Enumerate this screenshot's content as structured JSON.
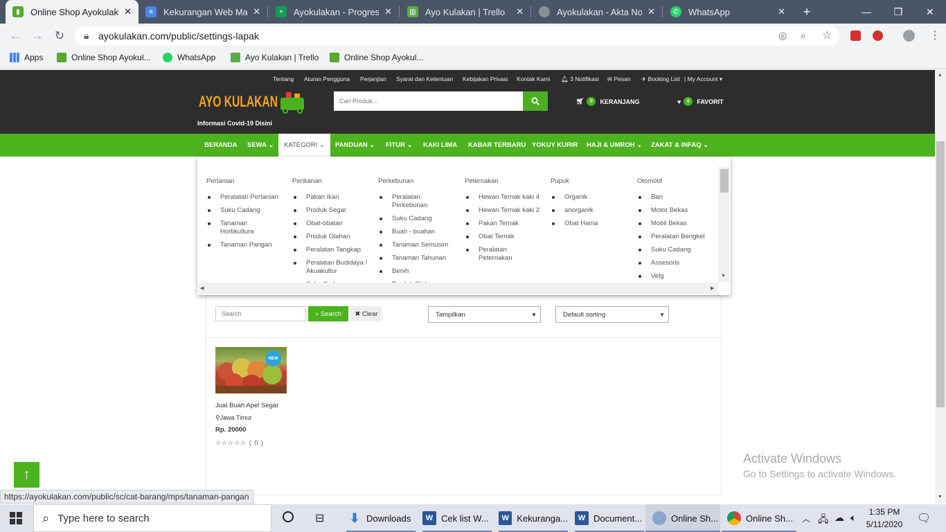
{
  "browser": {
    "tabs": [
      {
        "title": "Online Shop Ayokulakan",
        "active": true
      },
      {
        "title": "Kekurangan Web Market"
      },
      {
        "title": "Ayokulakan - Progress"
      },
      {
        "title": "Ayo Kulakan | Trello"
      },
      {
        "title": "Ayokulakan - Akta Notaris"
      },
      {
        "title": "WhatsApp"
      }
    ],
    "url": "ayokulakan.com/public/settings-lapak",
    "bookmarks": [
      "Apps",
      "Online Shop Ayokul...",
      "WhatsApp",
      "Ayo Kulakan | Trello",
      "Online Shop Ayokul..."
    ],
    "status_url": "https://ayokulakan.com/public/sc/cat-barang/mps/tanaman-pangan"
  },
  "site": {
    "top_links": [
      "Tentang",
      "Aturan Pengguna",
      "Perjanjian",
      "Syarat dan Ketentuan",
      "Kebijakan Privasi",
      "Kontak Kami",
      "3 Notifikasi",
      "Pesan",
      "Booking List",
      "| My Account"
    ],
    "logo_text": "AYO KULAKAN",
    "covid_text": "Informasi Covid-19 Disini",
    "search_placeholder": "Cari Produk...",
    "cart_label": "KERANJANG",
    "cart_count": "0",
    "fav_label": "FAVORIT",
    "fav_count": "0",
    "nav": [
      "BERANDA",
      "SEWA",
      "KATEGORI",
      "PANDUAN",
      "FITUR",
      "KAKI LIMA",
      "KABAR TERBARU",
      "YOKUY KURIR",
      "HAJI & UMROH",
      "ZAKAT & INFAQ"
    ],
    "accent_color": "#4cb21e"
  },
  "mega_menu": {
    "columns": [
      {
        "title": "Pertanian",
        "items": [
          "Peralatan Pertanian",
          "Suku Cadang",
          "Tanaman Hortikultura",
          "Tanaman Pangan"
        ]
      },
      {
        "title": "Perikanan",
        "items": [
          "Pakan Ikan",
          "Produk Segar",
          "Obat-obatan",
          "Produk Olahan",
          "Peralatan Tangkap",
          "Peralatan Budidaya / Akuakultur",
          "Suku Cadang"
        ]
      },
      {
        "title": "Perkebunan",
        "items": [
          "Peralatan Perkebunan",
          "Suku Cadang",
          "Buah - buahan",
          "Tanaman Semusim",
          "Tanaman Tahunan",
          "Benih",
          "Produk Olahan"
        ]
      },
      {
        "title": "Peternakan",
        "items": [
          "Hewan Ternak kaki 4",
          "Hewan Ternak kaki 2",
          "Pakan Ternak",
          "Obat Ternak",
          "Peralatan Peternakan"
        ]
      },
      {
        "title": "Pupuk",
        "items": [
          "Organik",
          "anorganik",
          "Obat Hama"
        ]
      },
      {
        "title": "Otomotif",
        "items": [
          "Ban",
          "Motor Bekas",
          "Mobil Bekas",
          "Peralatan Bengkel",
          "Suku Cadang",
          "Assesoris",
          "Velg"
        ]
      }
    ]
  },
  "filters": {
    "search_placeholder": "Search",
    "search_btn": "Search",
    "clear_btn": "Clear",
    "view_select": "Tampilkan",
    "sort_select": "Default sorting"
  },
  "product": {
    "badge": "NEW",
    "name": "Jual Buah Apel Segar",
    "location": "Jawa Timur",
    "price": "Rp. 20000",
    "rating": "☆☆☆☆☆ ( 0 )"
  },
  "windows": {
    "watermark_title": "Activate Windows",
    "watermark_sub": "Go to Settings to activate Windows.",
    "search_placeholder": "Type here to search",
    "taskbar_apps": [
      "Downloads",
      "Cek list W...",
      "Kekuranga...",
      "Document...",
      "Online Sh...",
      "Online Sh..."
    ],
    "time": "1:35 PM",
    "date": "5/11/2020"
  }
}
